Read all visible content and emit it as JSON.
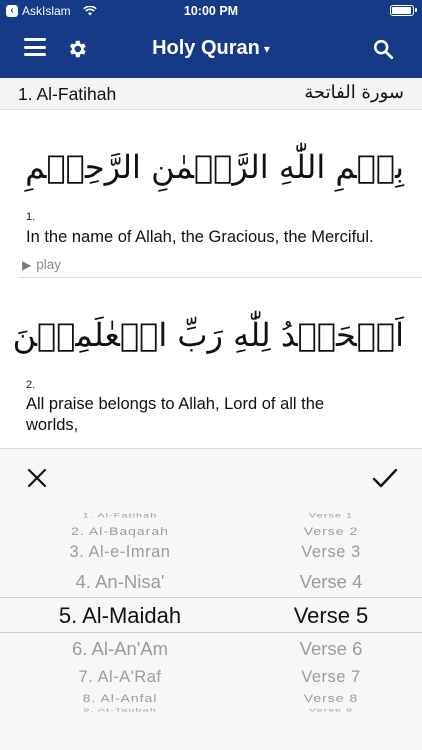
{
  "status_bar": {
    "carrier": "AskIslam",
    "time": "10:00 PM"
  },
  "nav": {
    "title": "Holy Quran",
    "caret": "▾"
  },
  "surah_header": {
    "name": "1.  Al-Fatihah",
    "arabic": "سورة الفاتحة"
  },
  "verses": [
    {
      "arabic": "بِسۡمِ اللّٰهِ الرَّحۡمٰنِ الرَّحِيۡمِ",
      "number": "1.",
      "english": "In the name of Allah, the Gracious, the Merciful.",
      "play_label": "play"
    },
    {
      "arabic": "اَلۡحَمۡدُ لِلّٰهِ رَبِّ الۡعٰلَمِيۡنَ",
      "number": "2.",
      "english": "All praise belongs to Allah, Lord of all the worlds,"
    }
  ],
  "picker": {
    "surahs": [
      "1. Al-Fatihah",
      "2. Al-Baqarah",
      "3. Al-e-Imran",
      "4. An-Nisa'",
      "5. Al-Maidah",
      "6. Al-An'Am",
      "7. Al-A'Raf",
      "8. Al-Anfal",
      "9. At-Taubah"
    ],
    "verses": [
      "Verse 1",
      "Verse 2",
      "Verse 3",
      "Verse 4",
      "Verse 5",
      "Verse 6",
      "Verse 7",
      "Verse 8",
      "Verse 9"
    ],
    "selected_surah": "5. Al-Maidah",
    "selected_verse": "Verse 5"
  },
  "colors": {
    "nav_background": "#163a86",
    "sheet_background": "#f7f7f8"
  }
}
